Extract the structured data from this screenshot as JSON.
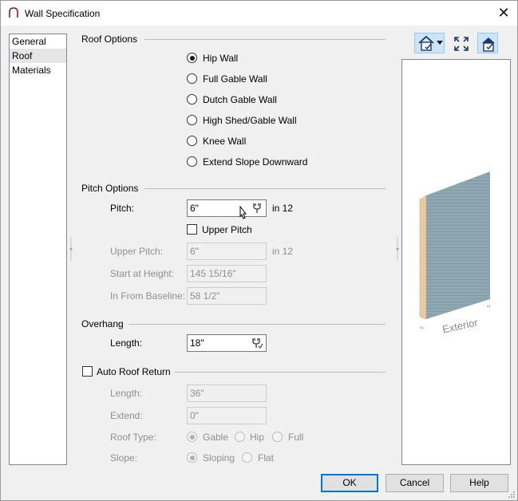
{
  "window": {
    "title": "Wall Specification"
  },
  "nav": {
    "items": [
      "General",
      "Roof",
      "Materials"
    ],
    "selected": "Roof"
  },
  "roof_options": {
    "title": "Roof Options",
    "options": [
      "Hip Wall",
      "Full Gable Wall",
      "Dutch Gable Wall",
      "High Shed/Gable Wall",
      "Knee Wall",
      "Extend Slope Downward"
    ],
    "selected": "Hip Wall"
  },
  "pitch_options": {
    "title": "Pitch Options",
    "pitch_label": "Pitch:",
    "pitch_value": "6\"",
    "pitch_unit": "in 12",
    "upper_pitch_check_label": "Upper Pitch",
    "upper_pitch_label": "Upper Pitch:",
    "upper_pitch_value": "6\"",
    "upper_pitch_unit": "in 12",
    "start_height_label": "Start at Height:",
    "start_height_value": "145 15/16\"",
    "in_from_baseline_label": "In From Baseline:",
    "in_from_baseline_value": "58 1/2\""
  },
  "overhang": {
    "title": "Overhang",
    "length_label": "Length:",
    "length_value": "18\""
  },
  "auto_roof_return": {
    "title": "Auto Roof Return",
    "length_label": "Length:",
    "length_value": "36\"",
    "extend_label": "Extend:",
    "extend_value": "0\"",
    "roof_type_label": "Roof Type:",
    "roof_type_options": [
      "Gable",
      "Hip",
      "Full"
    ],
    "roof_type_selected": "Gable",
    "slope_label": "Slope:",
    "slope_options": [
      "Sloping",
      "Flat"
    ],
    "slope_selected": "Sloping"
  },
  "preview": {
    "label": "Exterior"
  },
  "buttons": {
    "ok": "OK",
    "cancel": "Cancel",
    "help": "Help"
  },
  "colors": {
    "accent": "#0078d7",
    "wall_face": "#8fa9b4",
    "wall_edge": "#e8c9a0"
  }
}
